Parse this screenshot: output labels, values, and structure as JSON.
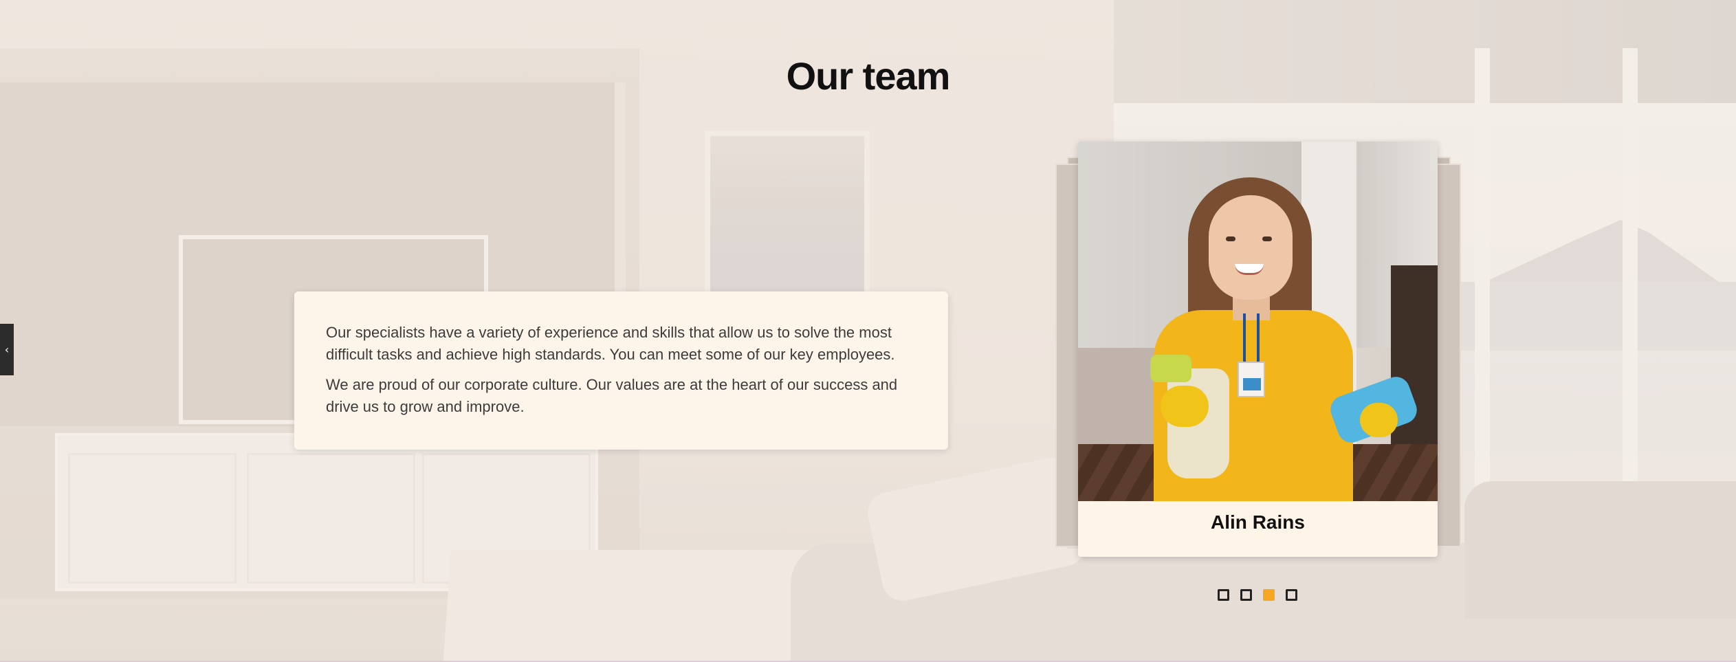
{
  "section": {
    "title": "Our team"
  },
  "intro": {
    "paragraphs": [
      "Our specialists have a variety of experience and skills that allow us to solve the most difficult tasks and achieve high standards. You can meet some of our key employees.",
      "We are proud of our corporate culture. Our values are at the heart of our success and drive us to grow and improve."
    ]
  },
  "slider": {
    "prev_icon": "chevron-left-icon",
    "prev_glyph": "‹",
    "current_member": {
      "name": "Alin Rains"
    },
    "dots": [
      {
        "active": false
      },
      {
        "active": false
      },
      {
        "active": true
      },
      {
        "active": false
      }
    ],
    "active_dot_color": "#f5a623"
  },
  "colors": {
    "card_background": "#fef4e8",
    "intro_background": "#fef5ea",
    "title": "#111111"
  }
}
